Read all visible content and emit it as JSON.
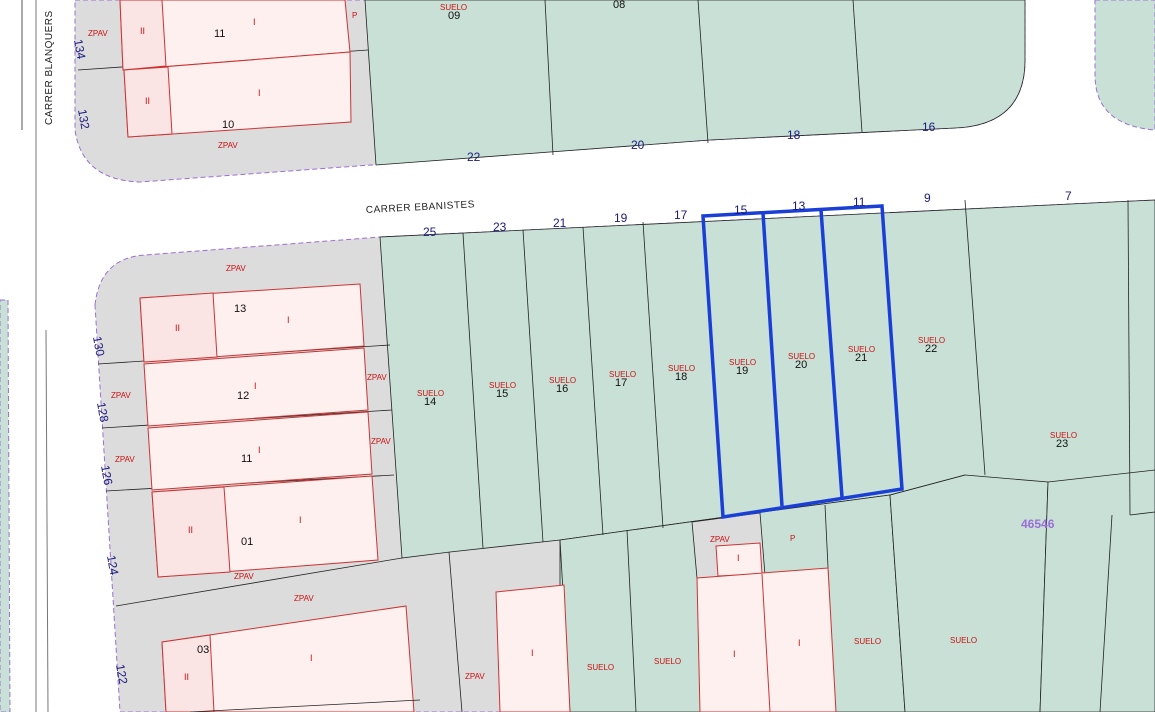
{
  "colors": {
    "block_fill": "#c8e0d6",
    "paved_fill": "#dcdcdc",
    "building_fill": "#fff0f0",
    "building_stroke": "#cc3333",
    "highlight": "#1a3fd6",
    "boundary": "#9a6fd6",
    "number_text": "#1a1a80",
    "label_text": "#cc1111"
  },
  "streets": {
    "ebanistes": "CARRER EBANISTES",
    "blanquers": "CARRER BLANQUERS"
  },
  "street_numbers": {
    "north_side": [
      "22",
      "20",
      "18",
      "16"
    ],
    "south_side": [
      "25",
      "23",
      "21",
      "19",
      "17",
      "15",
      "13",
      "11",
      "9",
      "7"
    ],
    "blanquers_side": [
      "134",
      "132",
      "130",
      "128",
      "126",
      "124",
      "122"
    ]
  },
  "north_block": {
    "parcels": [
      "09",
      "08",
      "11",
      "10"
    ],
    "labels": {
      "zpav": "ZPAV",
      "suelo": "SUELO",
      "p": "P",
      "roman_1": "I",
      "roman_2": "II"
    }
  },
  "west_block": {
    "parcels": [
      "13",
      "12",
      "11",
      "01"
    ],
    "labels": {
      "zpav": "ZPAV",
      "roman_1": "I",
      "roman_2": "II"
    }
  },
  "strip_parcels": [
    "14",
    "15",
    "16",
    "17",
    "18",
    "19",
    "20",
    "21",
    "22",
    "23"
  ],
  "strip_label": "SUELO",
  "highlighted_parcels": [
    "19",
    "20",
    "21"
  ],
  "south_block": {
    "parcels": [
      "03"
    ],
    "labels": {
      "zpav": "ZPAV",
      "suelo": "SUELO",
      "p": "P",
      "roman_1": "I",
      "roman_2": "II"
    }
  },
  "reference_number": "46546"
}
